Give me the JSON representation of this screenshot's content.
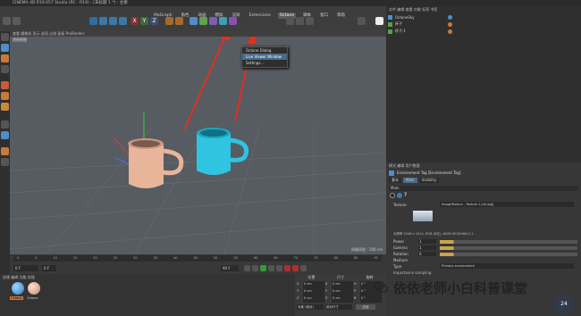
{
  "window": {
    "title": "CINEMA 4D R19.057 Studio (RC - R19) - [未标题 1 *] - 主要"
  },
  "menubar": {
    "items": [
      "MoGraph",
      "角色",
      "动画",
      "模拟",
      "渲染",
      "Extensions",
      "Octane",
      "脚本",
      "窗口",
      "帮助"
    ],
    "active_index": 6
  },
  "octane_menu": {
    "items": [
      "Octane Dialog",
      "Live Viewer Window",
      "Settings..."
    ],
    "selected_index": 1
  },
  "viewport": {
    "header": "查看 摄像机 显示 选项 过滤 面板 ProRender",
    "label": "透视视图",
    "grid_info": "网格间距 : 100 cm"
  },
  "timeline": {
    "start": "0 F",
    "end": "90 F",
    "current": "0 F",
    "ticks": [
      "0",
      "5",
      "10",
      "15",
      "20",
      "25",
      "30",
      "35",
      "40",
      "45",
      "50",
      "55",
      "60",
      "65",
      "70",
      "75",
      "80",
      "85",
      "90"
    ]
  },
  "materials": {
    "menu": "创建 编辑 功能 纹理",
    "items": [
      "Octane",
      "Octane"
    ]
  },
  "coords": {
    "labels": [
      "位置",
      "尺寸",
      "旋转"
    ],
    "rows": [
      [
        "X",
        "0 cm",
        "X",
        "0 cm",
        "H",
        "0 °"
      ],
      [
        "Y",
        "0 cm",
        "Y",
        "0 cm",
        "P",
        "0 °"
      ],
      [
        "Z",
        "0 cm",
        "Z",
        "0 cm",
        "B",
        "0 °"
      ]
    ],
    "mode": "对象 (相对)",
    "size_mode": "绝对尺寸",
    "apply": "应用"
  },
  "objmgr": {
    "menu": "文件 编辑 查看 对象 标签 书签",
    "objects": [
      "OctaneSky",
      "杯子",
      "杯子.1"
    ]
  },
  "attrmgr": {
    "menu": "模式 编辑 用户数据",
    "tag_title": "Environment Tag [Environment Tag]",
    "tabs": [
      "基本",
      "Main",
      "Visibility"
    ],
    "section": "Main",
    "texture_label": "Texture",
    "texture_value": "ImageTexture - Texture 1 [rel.jpg]",
    "fields": [
      {
        "label": "Power",
        "value": "1"
      },
      {
        "label": "Gamma",
        "value": "1"
      },
      {
        "label": "Rotation",
        "value": "0"
      }
    ],
    "image_info": "分辨率 2048 x 1024, RGB (8位), sRGB IEC61966-2.1",
    "medium_label": "Medium",
    "type_label": "Type",
    "type_value": "Primary environment",
    "importance_label": "Importance sampling"
  },
  "watermark": {
    "text": "依依老师小白科普课堂",
    "badge": "24"
  },
  "colors": {
    "mug_pink": "#e8b49a",
    "mug_cyan": "#2fc4e0",
    "accent_blue": "#4a6a8a",
    "arrow_red": "#e03020"
  }
}
